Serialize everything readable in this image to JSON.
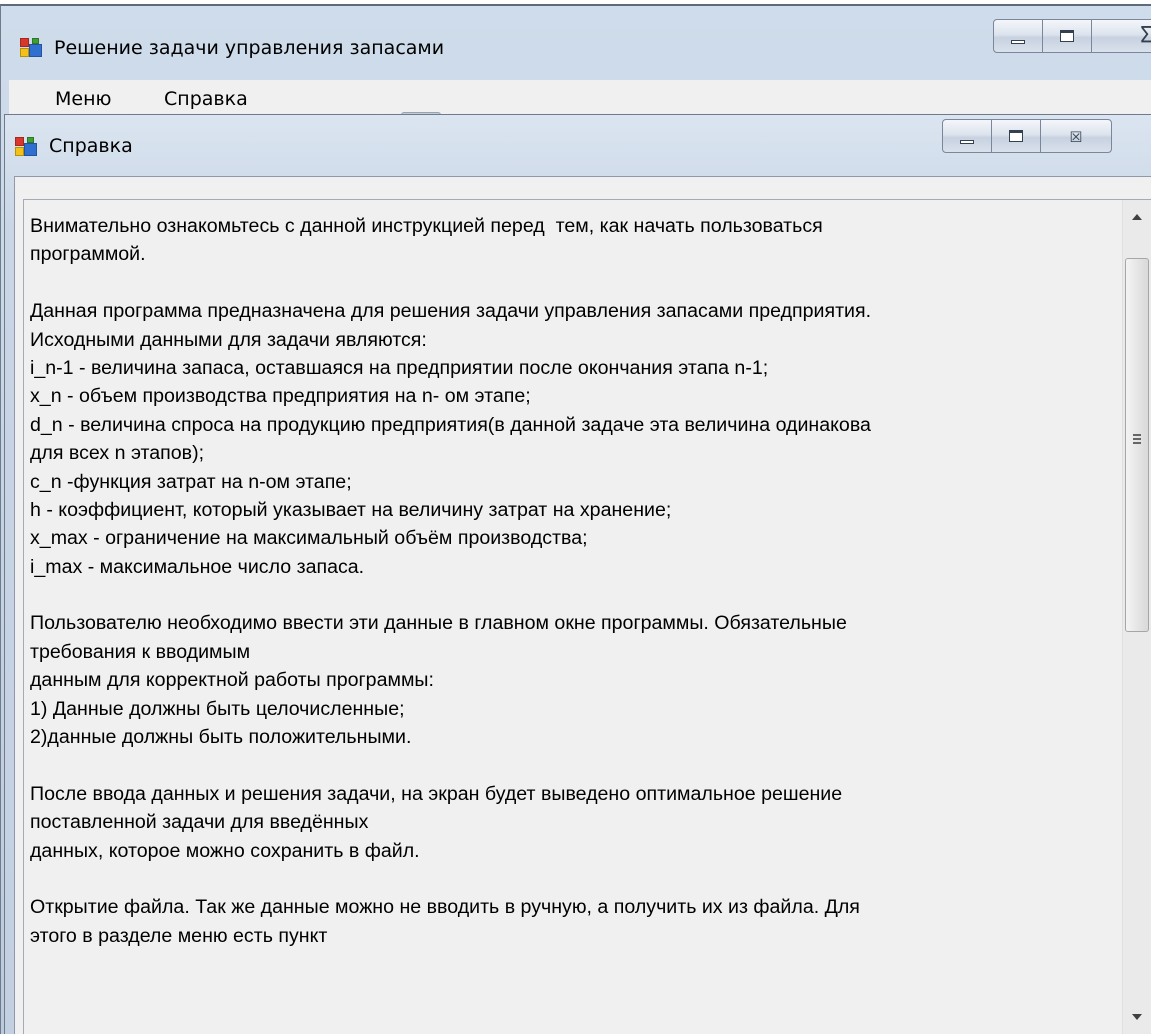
{
  "main_window": {
    "title": "Решение задачи управления запасами",
    "close_glyph": "Σ"
  },
  "menu": {
    "items": [
      "Меню",
      "Справка"
    ]
  },
  "help_window": {
    "title": "Справка",
    "close_glyph": "☒",
    "text_lines": [
      "Внимательно ознакомьтесь с данной инструкцией перед  тем, как начать пользоваться",
      "программой.",
      "",
      "Данная программа предназначена для решения задачи управления запасами предприятия.",
      "Исходными данными для задачи являются:",
      "i_n-1 - величина запаса, оставшаяся на предприятии после окончания этапа n-1;",
      "x_n - объем производства предприятия на n- ом этапе;",
      "d_n - величина спроса на продукцию предприятия(в данной задаче эта величина одинакова",
      "для всех n этапов);",
      "c_n -функция затрат на n-ом этапе;",
      "h - коэффициент, который указывает на величину затрат на хранение;",
      "x_max - ограничение на максимальный объём производства;",
      "i_max - максимальное число запаса.",
      "",
      "Пользователю необходимо ввести эти данные в главном окне программы. Обязательные",
      "требования к вводимым",
      "данным для корректной работы программы:",
      "1) Данные должны быть целочисленные;",
      "2)данные должны быть положительными.",
      "",
      "После ввода данных и решения задачи, на экран будет выведено оптимальное решение",
      "поставленной задачи для введённых",
      "данных, которое можно сохранить в файл.",
      "",
      "Открытие файла. Так же данные можно не вводить в ручную, а получить их из файла. Для",
      "этого в разделе меню есть пункт"
    ],
    "scrollbar": {
      "position_fraction": 0,
      "visible_fraction": 0.45
    }
  },
  "icons": {
    "app_icon": "windows-form-icon",
    "minimize": "minimize-icon",
    "maximize": "maximize-icon",
    "close": "close-icon"
  },
  "colors": {
    "titlebar": "#c6d3e4",
    "client_background": "#f0f0f0",
    "icon_red": "#d9372b",
    "icon_blue": "#2f6fd0",
    "icon_green": "#3f9f36",
    "icon_yellow": "#f2c218"
  }
}
